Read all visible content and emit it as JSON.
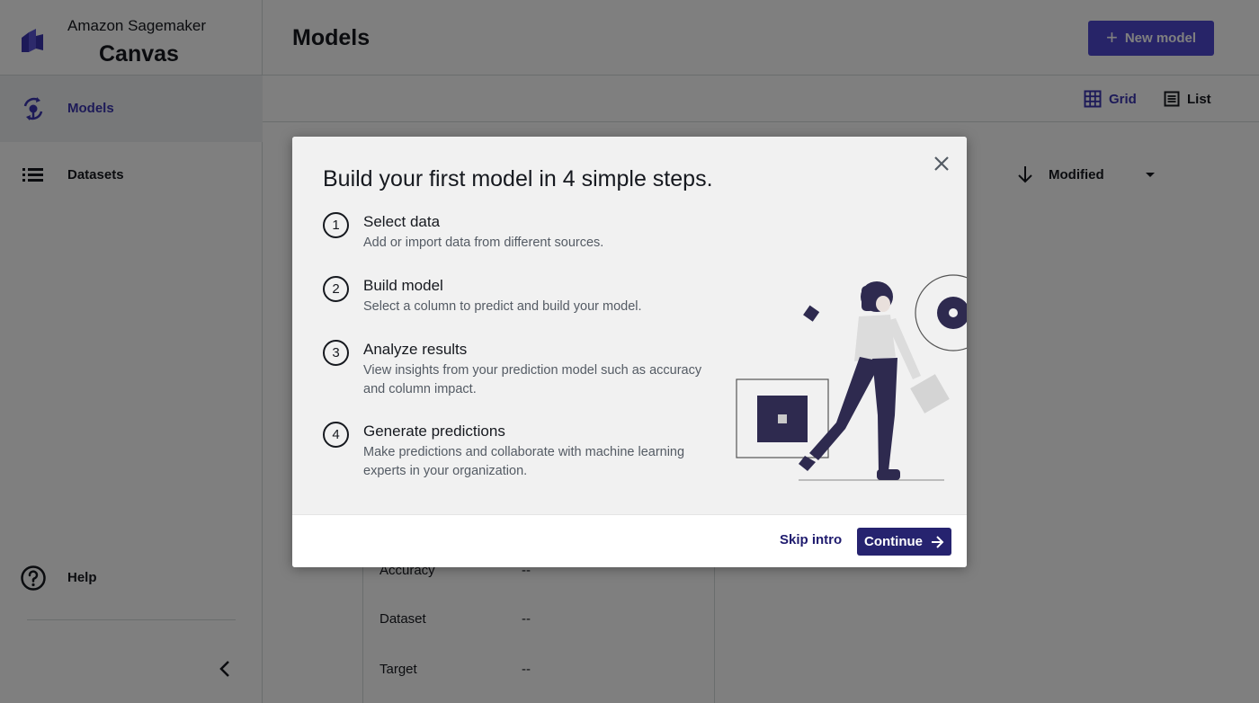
{
  "brand": {
    "line1": "Amazon Sagemaker",
    "line2": "Canvas"
  },
  "sidebar": {
    "items": [
      {
        "label": "Models",
        "icon": "models-icon",
        "active": true
      },
      {
        "label": "Datasets",
        "icon": "list-icon",
        "active": false
      }
    ],
    "help_label": "Help"
  },
  "header": {
    "title": "Models",
    "new_model_label": "New model"
  },
  "toolbar": {
    "grid_label": "Grid",
    "list_label": "List"
  },
  "sort": {
    "label": "Modified"
  },
  "model_card": {
    "rows": [
      {
        "label": "Accuracy",
        "value": "--"
      },
      {
        "label": "Dataset",
        "value": "--"
      },
      {
        "label": "Target",
        "value": "--"
      }
    ]
  },
  "modal": {
    "title": "Build your first model in 4 simple steps.",
    "steps": [
      {
        "number": "1",
        "title": "Select data",
        "description": "Add or import data from different sources."
      },
      {
        "number": "2",
        "title": "Build model",
        "description": "Select a column to predict and build your model."
      },
      {
        "number": "3",
        "title": "Analyze results",
        "description": "View insights from your prediction model such as accuracy and column impact."
      },
      {
        "number": "4",
        "title": "Generate predictions",
        "description": "Make predictions and collaborate with machine learning experts in your organization."
      }
    ],
    "skip_label": "Skip intro",
    "continue_label": "Continue"
  },
  "colors": {
    "accent": "#3b35b1",
    "primary_button": "#4e48d0",
    "continue_button": "#26236f",
    "illustration_dark": "#2e2a4f"
  }
}
